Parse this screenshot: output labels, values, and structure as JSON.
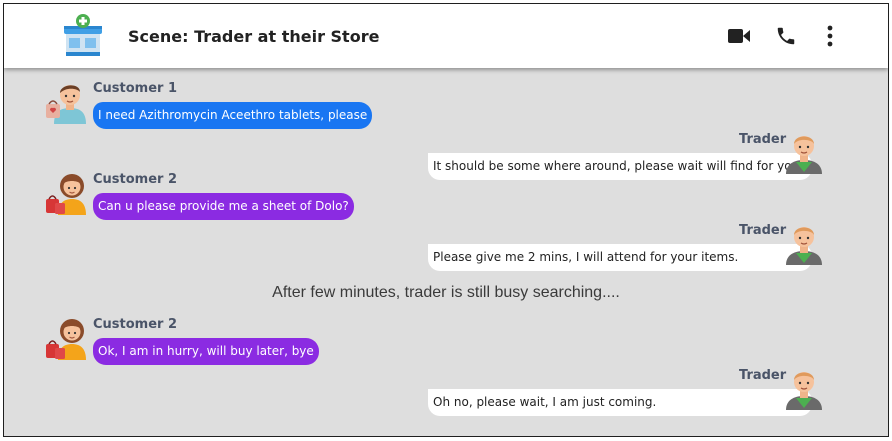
{
  "header": {
    "title": "Scene: Trader at their Store",
    "icons": [
      "store-icon",
      "video-call-icon",
      "phone-icon",
      "more-vert-icon"
    ]
  },
  "messages": [
    {
      "sender": "Customer 1",
      "text": "I need Azithromycin Aceethro tablets, please"
    },
    {
      "sender": "Trader",
      "text": "It should be some where around, please wait will find for you"
    },
    {
      "sender": "Customer 2",
      "text": "Can u please provide me a sheet of Dolo?"
    },
    {
      "sender": "Trader",
      "text": "Please give me 2 mins, I will attend for your items."
    },
    {
      "sender": "Customer 2",
      "text": "Ok, I am in hurry, will buy later, bye"
    },
    {
      "sender": "Trader",
      "text": "Oh no, please wait, I am just coming."
    }
  ],
  "narration": "After few minutes, trader is still busy searching....",
  "colors": {
    "customer1_bubble": "#1976f2",
    "customer2_bubble": "#8b2be2",
    "trader_bubble": "#ffffff",
    "background": "#dedede"
  }
}
